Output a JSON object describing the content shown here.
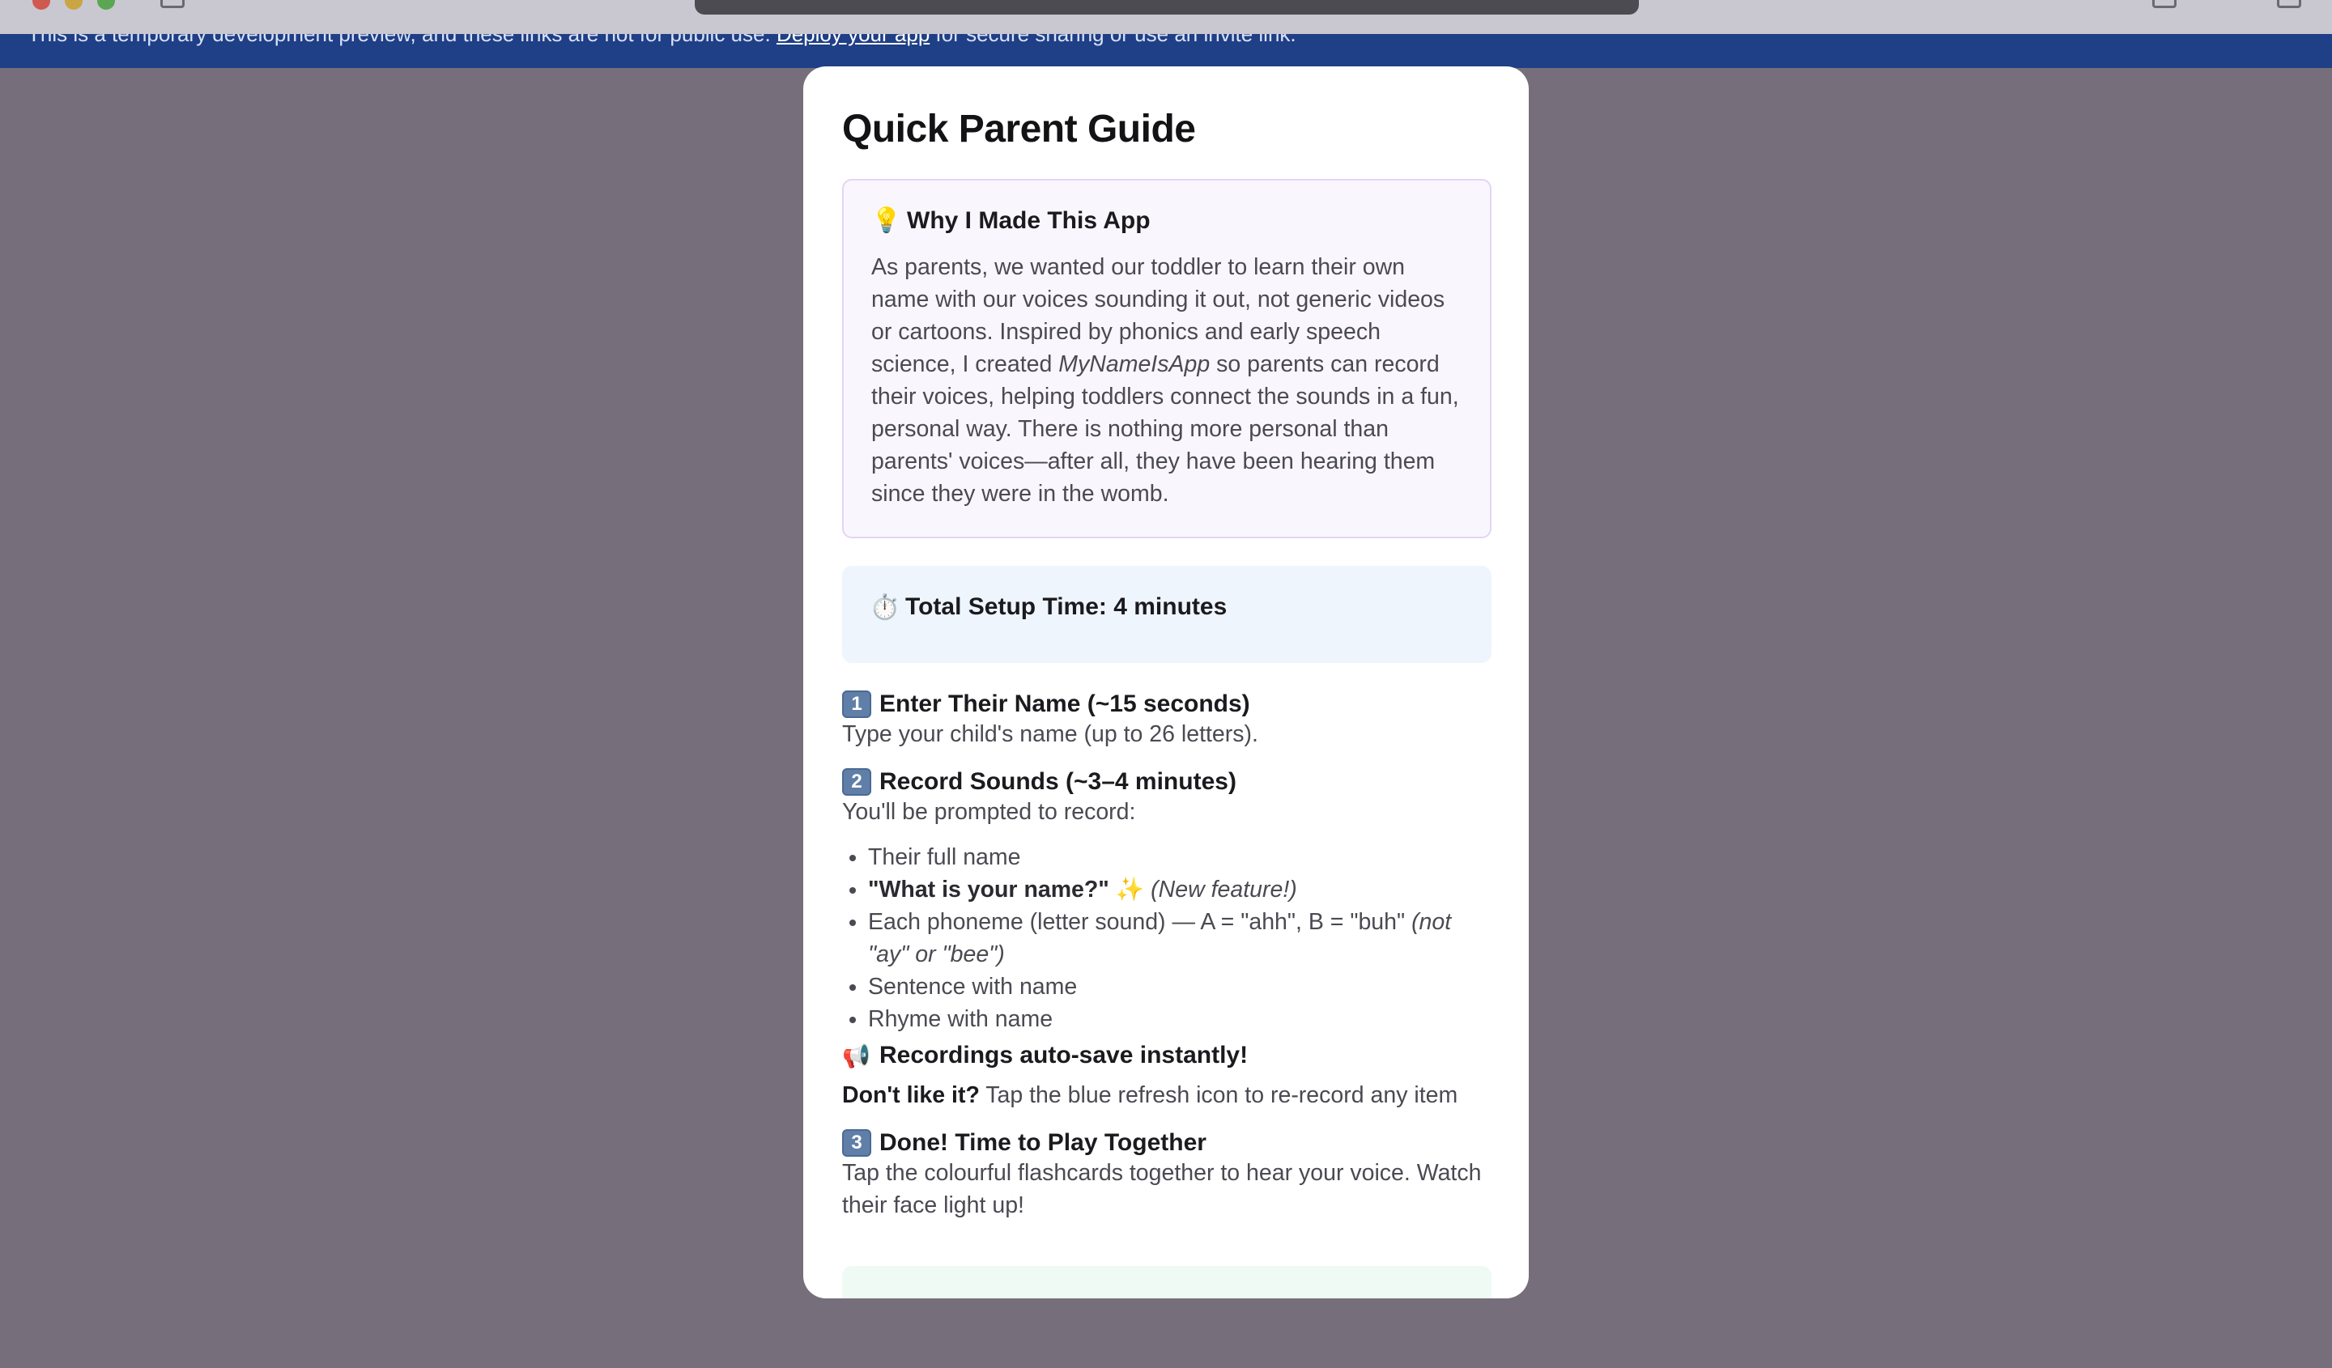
{
  "banner": {
    "text_before": "This is a temporary development preview, and these links are not for public use.",
    "link": "Deploy your app",
    "text_after": "for secure sharing or use an invite link.",
    "close": "✕"
  },
  "guide": {
    "title": "Quick Parent Guide",
    "why": {
      "icon": "💡",
      "title": "Why I Made This App",
      "text_1": "As parents, we wanted our toddler to learn their own name with our voices sounding it out, not generic videos or cartoons. Inspired by phonics and early speech science, I created",
      "app_name": "MyNameIsApp",
      "text_2": "so parents can record their voices, helping toddlers connect the sounds in a fun, personal way. There is nothing more personal than parents' voices—after all, they have been hearing them since they were in the womb."
    },
    "setup": {
      "icon": "⏱️",
      "text": "Total Setup Time: 4 minutes"
    },
    "step1": {
      "num": "1",
      "title": "Enter Their Name (~15 seconds)",
      "desc": "Type your child's name (up to 26 letters)."
    },
    "step2": {
      "num": "2",
      "title": "Record Sounds (~3–4 minutes)",
      "desc": "You'll be prompted to record:",
      "items": {
        "full_name": "Their full name",
        "what_is_name": "\"What is your name?\"",
        "sparkle": "✨",
        "new_feature": "(New feature!)",
        "phoneme": "Each phoneme (letter sound) — A = \"ahh\", B = \"buh\"",
        "phoneme_note": "(not \"ay\" or \"bee\")",
        "sentence": "Sentence with name",
        "rhyme": "Rhyme with name"
      }
    },
    "autosave": {
      "icon": "📢",
      "text": "Recordings auto-save instantly!"
    },
    "rerecord": {
      "lead": "Don't like it?",
      "text": "Tap the blue refresh icon to re-record any item"
    },
    "step3": {
      "num": "3",
      "title": "Done! Time to Play Together",
      "desc": "Tap the colourful flashcards together to hear your voice. Watch their face light up!"
    }
  }
}
